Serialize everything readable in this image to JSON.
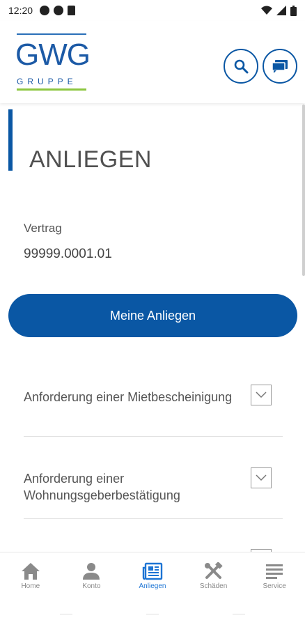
{
  "status_bar": {
    "time": "12:20"
  },
  "header": {
    "logo_word": "GWG",
    "logo_sub": "GRUPPE",
    "search_icon": "search-icon",
    "chat_icon": "chat-icon"
  },
  "page": {
    "title": "ANLIEGEN",
    "contract_label": "Vertrag",
    "contract_value": "99999.0001.01",
    "primary_button": "Meine Anliegen"
  },
  "requests": [
    {
      "label": "Anforderung einer Mietbescheinigung"
    },
    {
      "label": "Anforderung einer Wohnungsgeberbestätigung"
    }
  ],
  "bottom_nav": [
    {
      "label": "Home",
      "icon": "home-icon",
      "active": false
    },
    {
      "label": "Konto",
      "icon": "person-icon",
      "active": false
    },
    {
      "label": "Anliegen",
      "icon": "newspaper-icon",
      "active": true
    },
    {
      "label": "Schäden",
      "icon": "tools-icon",
      "active": false
    },
    {
      "label": "Service",
      "icon": "menu-icon",
      "active": false
    }
  ],
  "colors": {
    "brand_blue": "#0a57a4",
    "active_nav": "#1c74d4",
    "logo_green": "#8cc63f"
  }
}
